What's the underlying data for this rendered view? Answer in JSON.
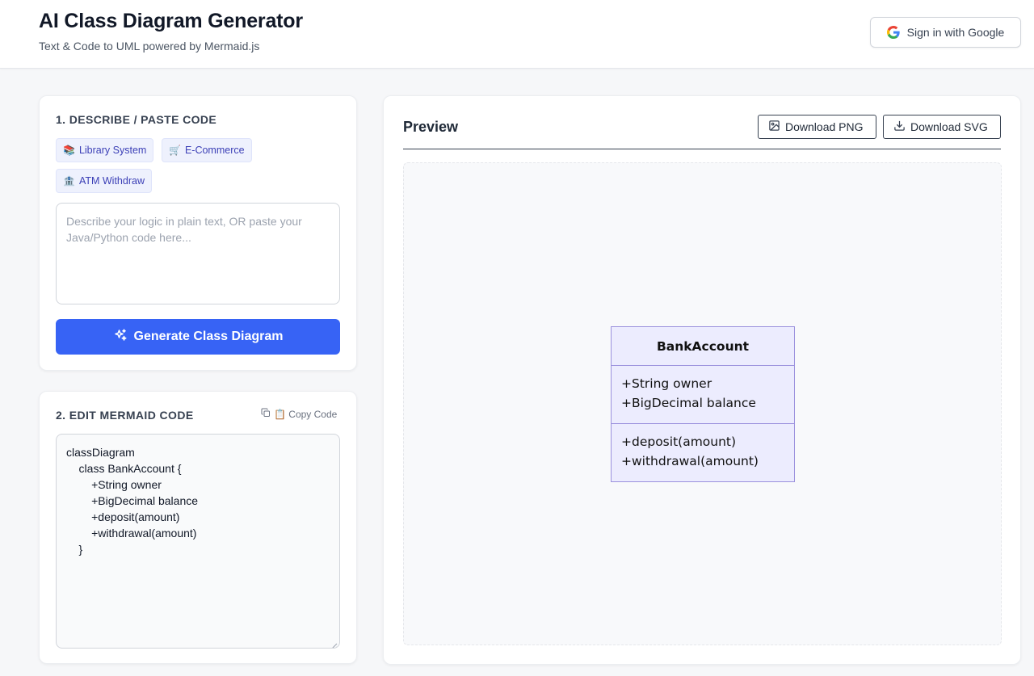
{
  "header": {
    "title": "AI Class Diagram Generator",
    "subtitle": "Text & Code to UML powered by Mermaid.js",
    "signin_label": "Sign in with Google"
  },
  "input_panel": {
    "title": "1. DESCRIBE / PASTE CODE",
    "examples": [
      {
        "emoji": "📚",
        "label": "Library System"
      },
      {
        "emoji": "🛒",
        "label": "E-Commerce"
      },
      {
        "emoji": "🏦",
        "label": "ATM Withdraw"
      }
    ],
    "placeholder": "Describe your logic in plain text, OR paste your Java/Python code here...",
    "generate_label": "Generate Class Diagram"
  },
  "code_panel": {
    "title": "2. EDIT MERMAID CODE",
    "copy_label": "📋 Copy Code",
    "code_lines": [
      "classDiagram",
      "    class BankAccount {",
      "        +String owner",
      "        +BigDecimal balance",
      "        +deposit(amount)",
      "        +withdrawal(amount)",
      "    }"
    ]
  },
  "preview": {
    "title": "Preview",
    "download_png": "Download PNG",
    "download_svg": "Download SVG",
    "diagram": {
      "class_name": "BankAccount",
      "attributes": [
        "+String owner",
        "+BigDecimal balance"
      ],
      "methods": [
        "+deposit(amount)",
        "+withdrawal(amount)"
      ]
    }
  },
  "colors": {
    "primary": "#3763f5",
    "chip_bg": "#eef1fd",
    "chip_text": "#3b3fb6",
    "uml_fill": "#ececfe",
    "uml_stroke": "#9b91dd"
  }
}
